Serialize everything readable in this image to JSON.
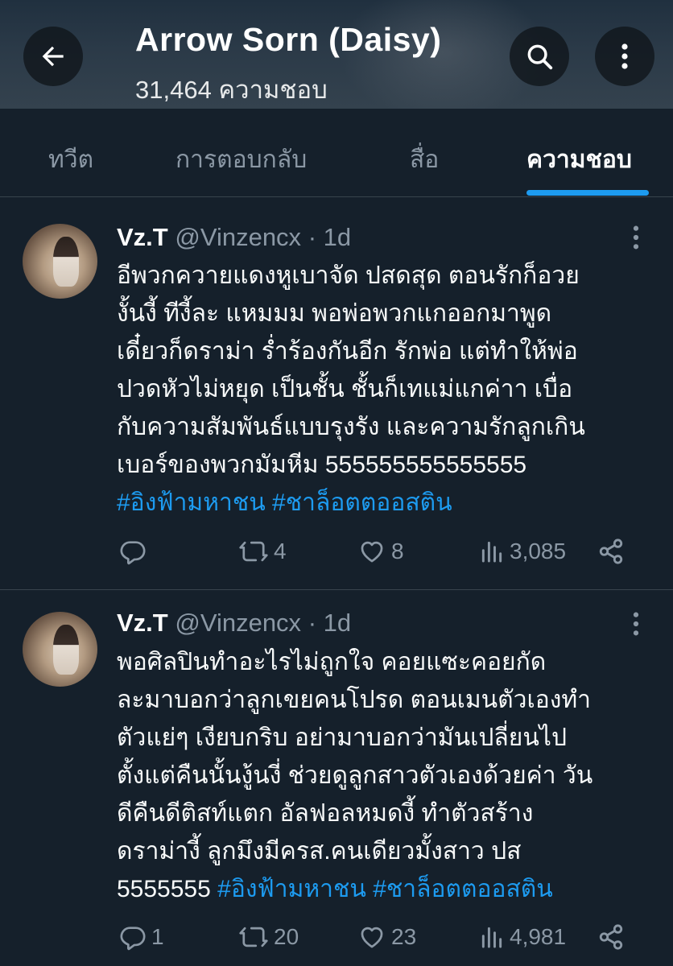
{
  "header": {
    "name": "Arrow Sorn (Daisy)",
    "likes_count": "31,464 ความชอบ"
  },
  "tabs": [
    {
      "label": "ทวีต",
      "active": false
    },
    {
      "label": "การตอบกลับ",
      "active": false
    },
    {
      "label": "สื่อ",
      "active": false
    },
    {
      "label": "ความชอบ",
      "active": true
    }
  ],
  "tweets": [
    {
      "author": "Vz.T",
      "handle": "@Vinzencx",
      "separator": "·",
      "time": "1d",
      "lines": [
        "อีพวกควายแดงหูเบาจัด ปสดสุด ตอนรักก็อวย",
        "งั้นงี้ ทีงี้ละ แหมมม พอพ่อพวกแกออกมาพูด",
        "เดี๋ยวก็ดราม่า ร่ำร้องกันอีก รักพ่อ แต่ทำให้พ่อ",
        "ปวดหัวไม่หยุด เป็นชั้น ชั้นก็เทแม่แกค่าา เบื่อ",
        "กับความสัมพันธ์แบบรุงรัง และความรักลูกเกิน",
        "เบอร์ของพวกมัมหีม 555555555555555"
      ],
      "hashtags": [
        "#อิงฟ้ามหาชน",
        "#ชาล็อตตออสติน"
      ],
      "replies": "",
      "retweets": "4",
      "likes": "8",
      "views": "3,085"
    },
    {
      "author": "Vz.T",
      "handle": "@Vinzencx",
      "separator": "·",
      "time": "1d",
      "lines": [
        "พอศิลปินทำอะไรไม่ถูกใจ คอยแซะคอยกัด",
        "ละมาบอกว่าลูกเขยคนโปรด ตอนเมนตัวเองทำ",
        "ตัวแย่ๆ เงียบกริบ อย่ามาบอกว่ามันเปลี่ยนไป",
        "ตั้งแต่คืนนั้นงู้นงี่ ช่วยดูลูกสาวตัวเองด้วยค่า วัน",
        "ดีคืนดีติสท์แตก อัลฟอลหมดงี้ ทำตัวสร้าง",
        "ดราม่างี้ ลูกมึงมีครส.คนเดียวมั้งสาว ปส"
      ],
      "last_line_text": "5555555",
      "hashtags": [
        "#อิงฟ้ามหาชน",
        "#ชาล็อตตออสติน"
      ],
      "replies": "1",
      "retweets": "20",
      "likes": "23",
      "views": "4,981"
    }
  ],
  "icons": {
    "back": "arrow-left-icon",
    "search": "search-icon",
    "more": "more-vertical-icon",
    "reply": "reply-icon",
    "retweet": "retweet-icon",
    "like": "heart-icon",
    "views": "views-icon",
    "share": "share-icon"
  },
  "colors": {
    "background": "#15202b",
    "accent": "#1d9bf0",
    "muted": "#8b98a5"
  }
}
